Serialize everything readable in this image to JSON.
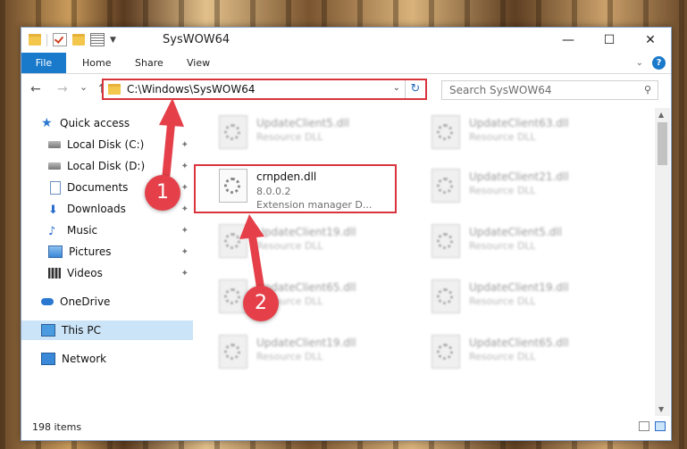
{
  "window": {
    "title": "SysWOW64",
    "controls": [
      "—",
      "☐",
      "✕"
    ]
  },
  "ribbon": {
    "tabs": [
      "File",
      "Home",
      "Share",
      "View"
    ]
  },
  "navigation": {
    "back": "←",
    "forward": "→",
    "recent": "⌄",
    "up": "↑",
    "address": "C:\\Windows\\SysWOW64",
    "search_placeholder": "Search SysWOW64"
  },
  "sidebar": {
    "items": [
      {
        "label": "Quick access",
        "icon": "star-icon"
      },
      {
        "label": "Local Disk (C:)",
        "icon": "disk-icon",
        "pinned": true
      },
      {
        "label": "Local Disk (D:)",
        "icon": "disk-icon",
        "pinned": true
      },
      {
        "label": "Documents",
        "icon": "documents-icon",
        "pinned": true
      },
      {
        "label": "Downloads",
        "icon": "download-icon",
        "pinned": true
      },
      {
        "label": "Music",
        "icon": "music-icon",
        "pinned": true
      },
      {
        "label": "Pictures",
        "icon": "pictures-icon",
        "pinned": true
      },
      {
        "label": "Videos",
        "icon": "videos-icon",
        "pinned": true
      },
      {
        "label": "OneDrive",
        "icon": "cloud-icon"
      },
      {
        "label": "This PC",
        "icon": "computer-icon",
        "selected": true
      },
      {
        "label": "Network",
        "icon": "network-icon"
      }
    ]
  },
  "files": [
    {
      "name": "UpdateClient5.dll",
      "type": "Resource DLL"
    },
    {
      "name": "UpdateClient63.dll",
      "type": "Resource DLL"
    },
    {
      "name": "crnpden.dll",
      "version": "8.0.0.2",
      "description": "Extension manager D...",
      "highlighted": true
    },
    {
      "name": "UpdateClient21.dll",
      "type": "Resource DLL"
    },
    {
      "name": "UpdateClient19.dll",
      "type": "Resource DLL"
    },
    {
      "name": "UpdateClient5.dll",
      "type": "Resource DLL"
    },
    {
      "name": "UpdateClient65.dll",
      "type": "Resource DLL"
    },
    {
      "name": "UpdateClient19.dll",
      "type": "Resource DLL"
    },
    {
      "name": "UpdateClient19.dll",
      "type": "Resource DLL"
    },
    {
      "name": "UpdateClient65.dll",
      "type": "Resource DLL"
    }
  ],
  "status": {
    "item_count": "198 items"
  },
  "annotations": {
    "step1": "1",
    "step2": "2",
    "color": "#e5404a"
  }
}
